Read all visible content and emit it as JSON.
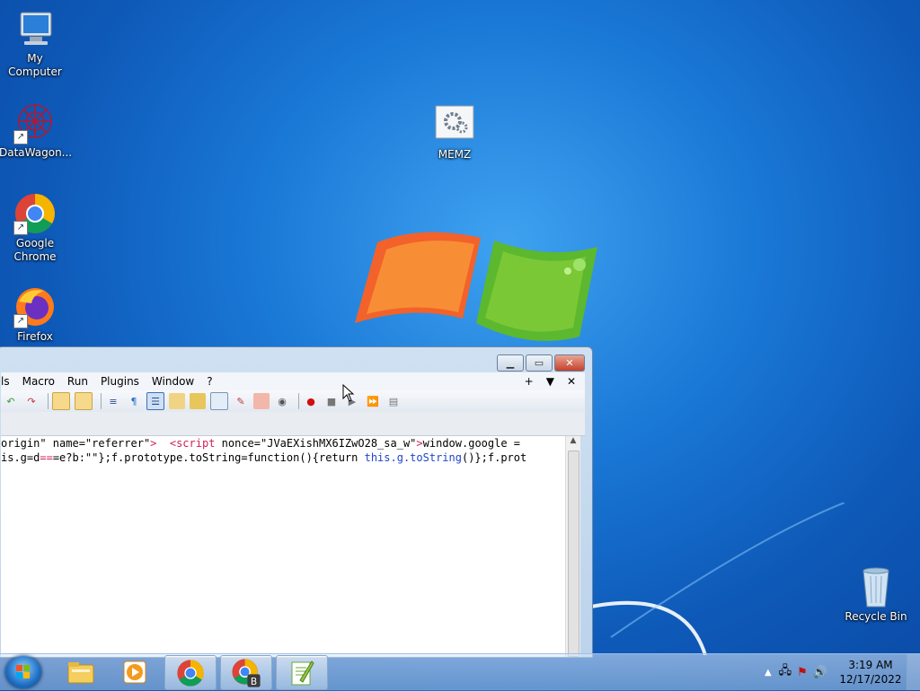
{
  "desktop": {
    "icons": [
      {
        "label": "My Computer",
        "icon": "computer-icon"
      },
      {
        "label": "DataWagon...",
        "icon": "datawagon-icon"
      },
      {
        "label": "Google Chrome",
        "icon": "chrome-icon"
      },
      {
        "label": "Firefox",
        "icon": "firefox-icon"
      },
      {
        "label": "MEMZ",
        "icon": "settings-file-icon"
      },
      {
        "label": "Recycle Bin",
        "icon": "recycle-bin-icon"
      }
    ]
  },
  "window": {
    "menu": [
      "ls",
      "Macro",
      "Run",
      "Plugins",
      "Window",
      "?"
    ],
    "menu_right": [
      "+",
      "▼",
      "✕"
    ],
    "code_line1": {
      "a": "origin\" name=\"referrer\"",
      "b": ">  ",
      "c": "<script",
      "d": " nonce=\"JVaEXishMX6IZwO28_sa_w\"",
      "e": ">",
      "f": "window.google ="
    },
    "code_line2": {
      "a": "is.g=d",
      "b": "==",
      "c": "=e?b:\"\"};f.prototype.toString=function(){return ",
      "d": "this.g.toString",
      "e": "()};f.prot"
    }
  },
  "taskbar": {
    "clock_time": "3:19 AM",
    "clock_date": "12/17/2022",
    "buttons": [
      "explorer-icon",
      "media-player-icon",
      "chrome-icon",
      "chrome-profile-icon",
      "notepadpp-icon"
    ]
  }
}
